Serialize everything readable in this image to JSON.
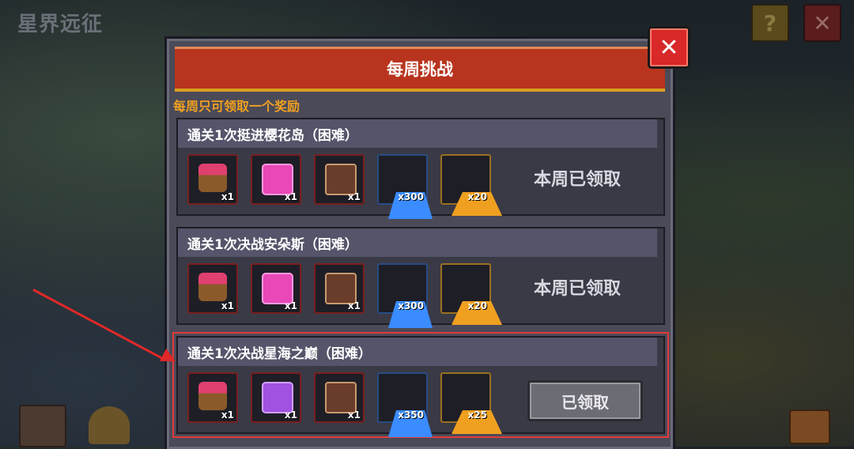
{
  "game": {
    "title": "星界远征",
    "help_label": "?",
    "close_label": "✕"
  },
  "dialog": {
    "title": "每周挑战",
    "close_label": "✕",
    "notice": "每周只可领取一个奖励"
  },
  "quests": [
    {
      "title": "通关1次挺进樱花岛（困难）",
      "status": "本周已领取",
      "rewards": [
        {
          "icon": "gem-chest-icon",
          "qty": "x1"
        },
        {
          "icon": "pink-chest-icon",
          "qty": "x1"
        },
        {
          "icon": "wood-chest-icon",
          "qty": "x1"
        },
        {
          "icon": "blue-crystal-icon",
          "qty": "x300"
        },
        {
          "icon": "gold-crystal-icon",
          "qty": "x20"
        }
      ]
    },
    {
      "title": "通关1次决战安朵斯（困难）",
      "status": "本周已领取",
      "rewards": [
        {
          "icon": "gem-chest-icon",
          "qty": "x1"
        },
        {
          "icon": "pink-chest-icon",
          "qty": "x1"
        },
        {
          "icon": "wood-chest-icon",
          "qty": "x1"
        },
        {
          "icon": "blue-crystal-icon",
          "qty": "x300"
        },
        {
          "icon": "gold-crystal-icon",
          "qty": "x20"
        }
      ]
    },
    {
      "title": "通关1次决战星海之巅（困难）",
      "button_label": "已领取",
      "rewards": [
        {
          "icon": "gem-chest-icon",
          "qty": "x1"
        },
        {
          "icon": "purple-chest-icon",
          "qty": "x1"
        },
        {
          "icon": "wood-chest-icon",
          "qty": "x1"
        },
        {
          "icon": "blue-crystal-icon",
          "qty": "x350"
        },
        {
          "icon": "gold-crystal-icon",
          "qty": "x25"
        }
      ]
    }
  ],
  "colors": {
    "header_red": "#b8341e",
    "notice_orange": "#f0a020",
    "highlight_red": "#e33a3a"
  }
}
